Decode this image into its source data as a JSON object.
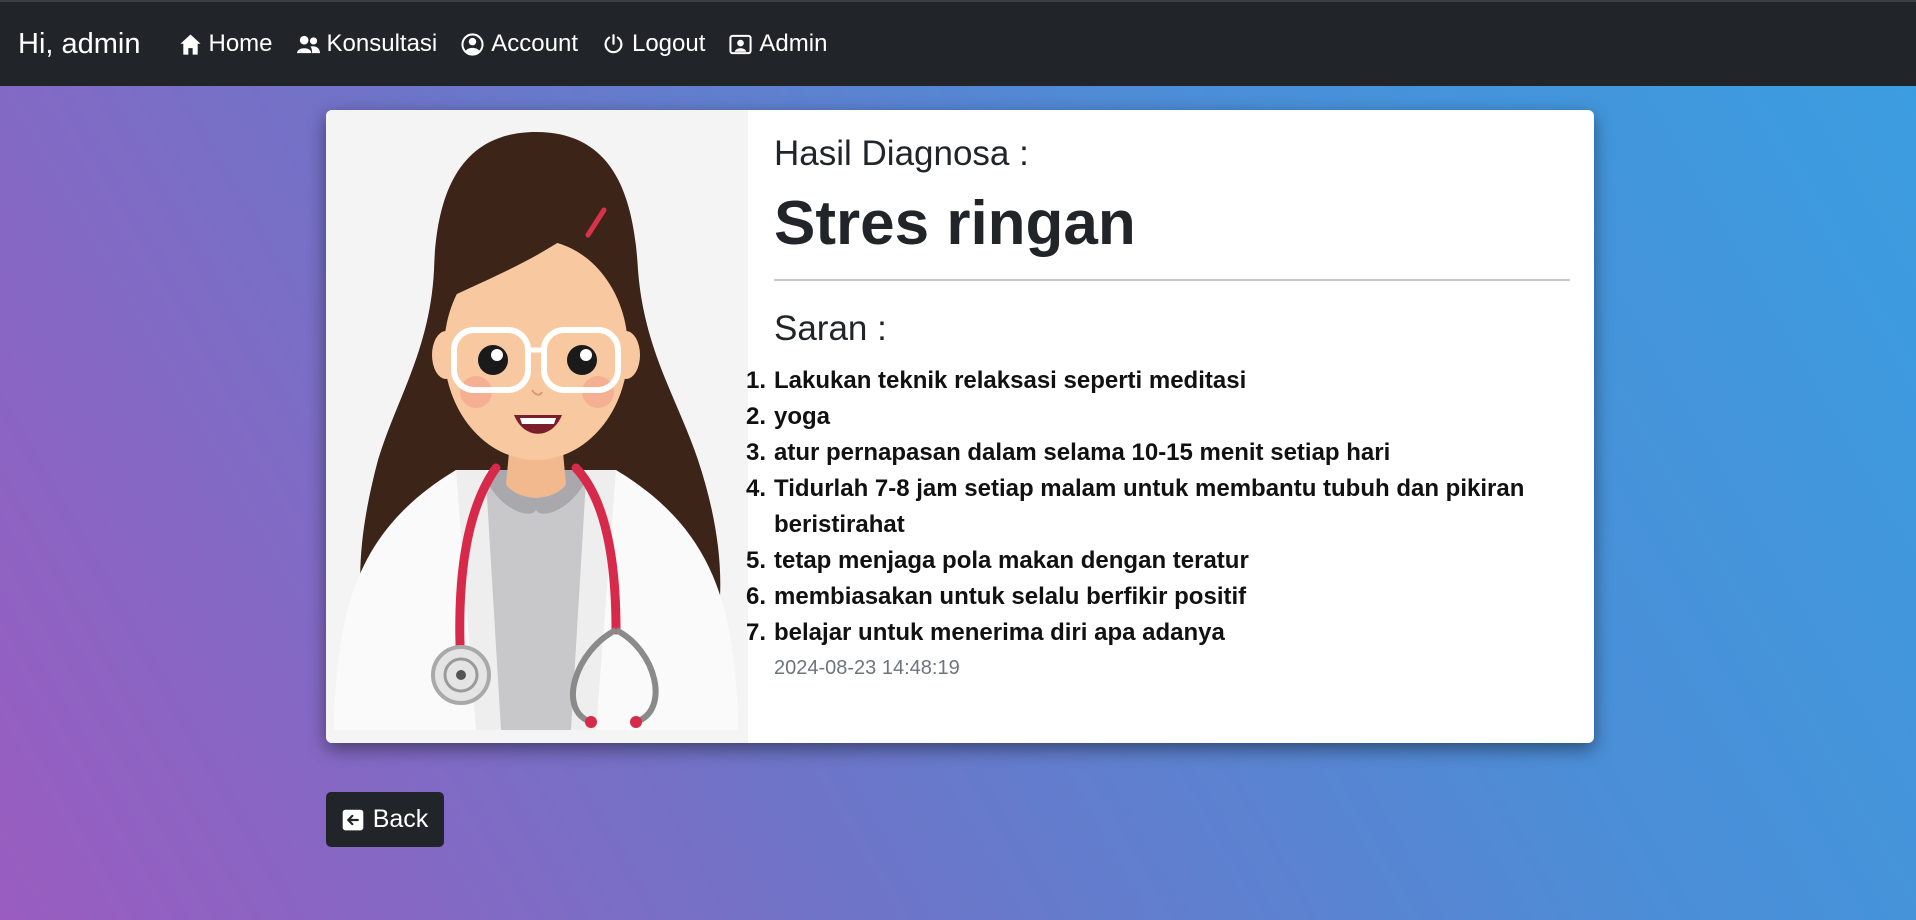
{
  "navbar": {
    "greeting": "Hi, admin",
    "items": [
      {
        "label": "Home",
        "icon": "house-icon"
      },
      {
        "label": "Konsultasi",
        "icon": "people-icon"
      },
      {
        "label": "Account",
        "icon": "person-circle-icon"
      },
      {
        "label": "Logout",
        "icon": "power-icon"
      },
      {
        "label": "Admin",
        "icon": "person-badge-icon"
      }
    ]
  },
  "result": {
    "heading": "Hasil Diagnosa :",
    "diagnosis": "Stres ringan",
    "advice_heading": "Saran :",
    "advice": [
      "Lakukan teknik relaksasi seperti meditasi",
      "yoga",
      "atur pernapasan dalam selama 10-15 menit setiap hari",
      "Tidurlah 7-8 jam setiap malam untuk membantu tubuh dan pikiran beristirahat",
      "tetap menjaga pola makan dengan teratur",
      "membiasakan untuk selalu berfikir positif",
      "belajar untuk menerima diri apa adanya"
    ],
    "timestamp": "2024-08-23 14:48:19"
  },
  "back_button": {
    "label": "Back",
    "icon": "arrow-left-square-icon"
  },
  "colors": {
    "navbar": "#212529",
    "gradient_left": "#9a5cc0",
    "gradient_right": "#3a9ee0"
  }
}
